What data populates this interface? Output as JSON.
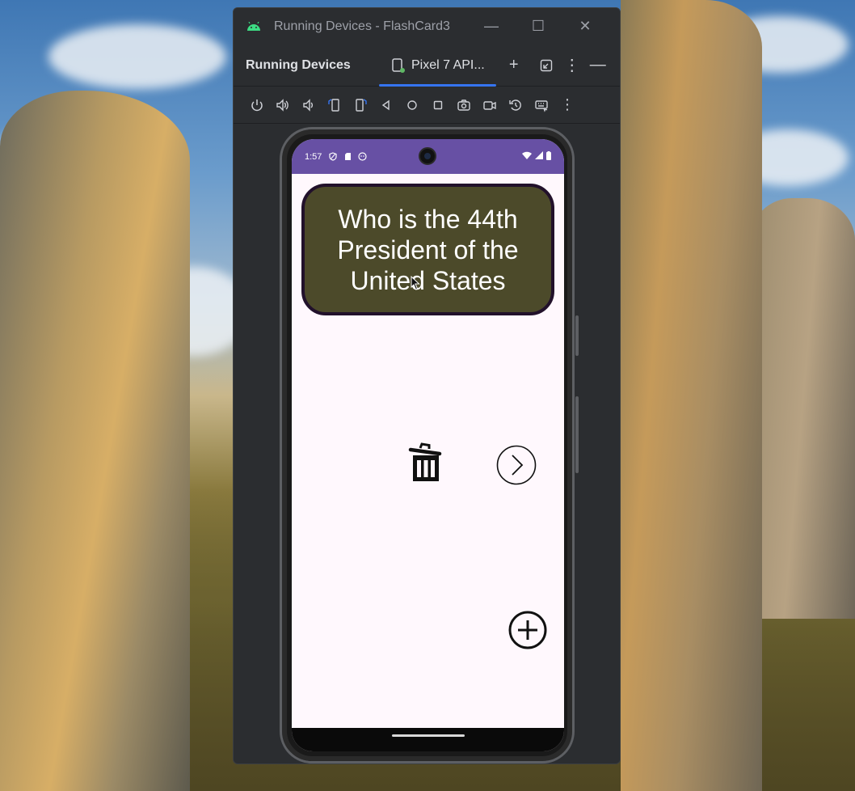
{
  "window": {
    "title": "Running Devices - FlashCard3",
    "minimize": "—",
    "maximize": "☐",
    "close": "✕"
  },
  "toolbar": {
    "panel_title": "Running Devices",
    "device_tab": "Pixel 7 API...",
    "add": "+",
    "more": "⋮",
    "hide": "—"
  },
  "device_controls": [
    "power-icon",
    "volume-up-icon",
    "volume-down-icon",
    "rotate-left-icon",
    "rotate-right-icon",
    "back-icon",
    "home-icon",
    "overview-icon",
    "screenshot-icon",
    "screen-record-icon",
    "reset-icon",
    "keyboard-icon",
    "more-icon"
  ],
  "phone": {
    "status": {
      "time": "1:57"
    },
    "card": {
      "text": "Who is the 44th President of the United States"
    },
    "colors": {
      "status_bar": "#6750a4",
      "card_bg": "#4c4a2a",
      "card_border": "#22112b",
      "screen_bg": "#fff8fd"
    }
  },
  "colors": {
    "ide_bg": "#2b2d30",
    "tab_underline": "#3574f0"
  }
}
